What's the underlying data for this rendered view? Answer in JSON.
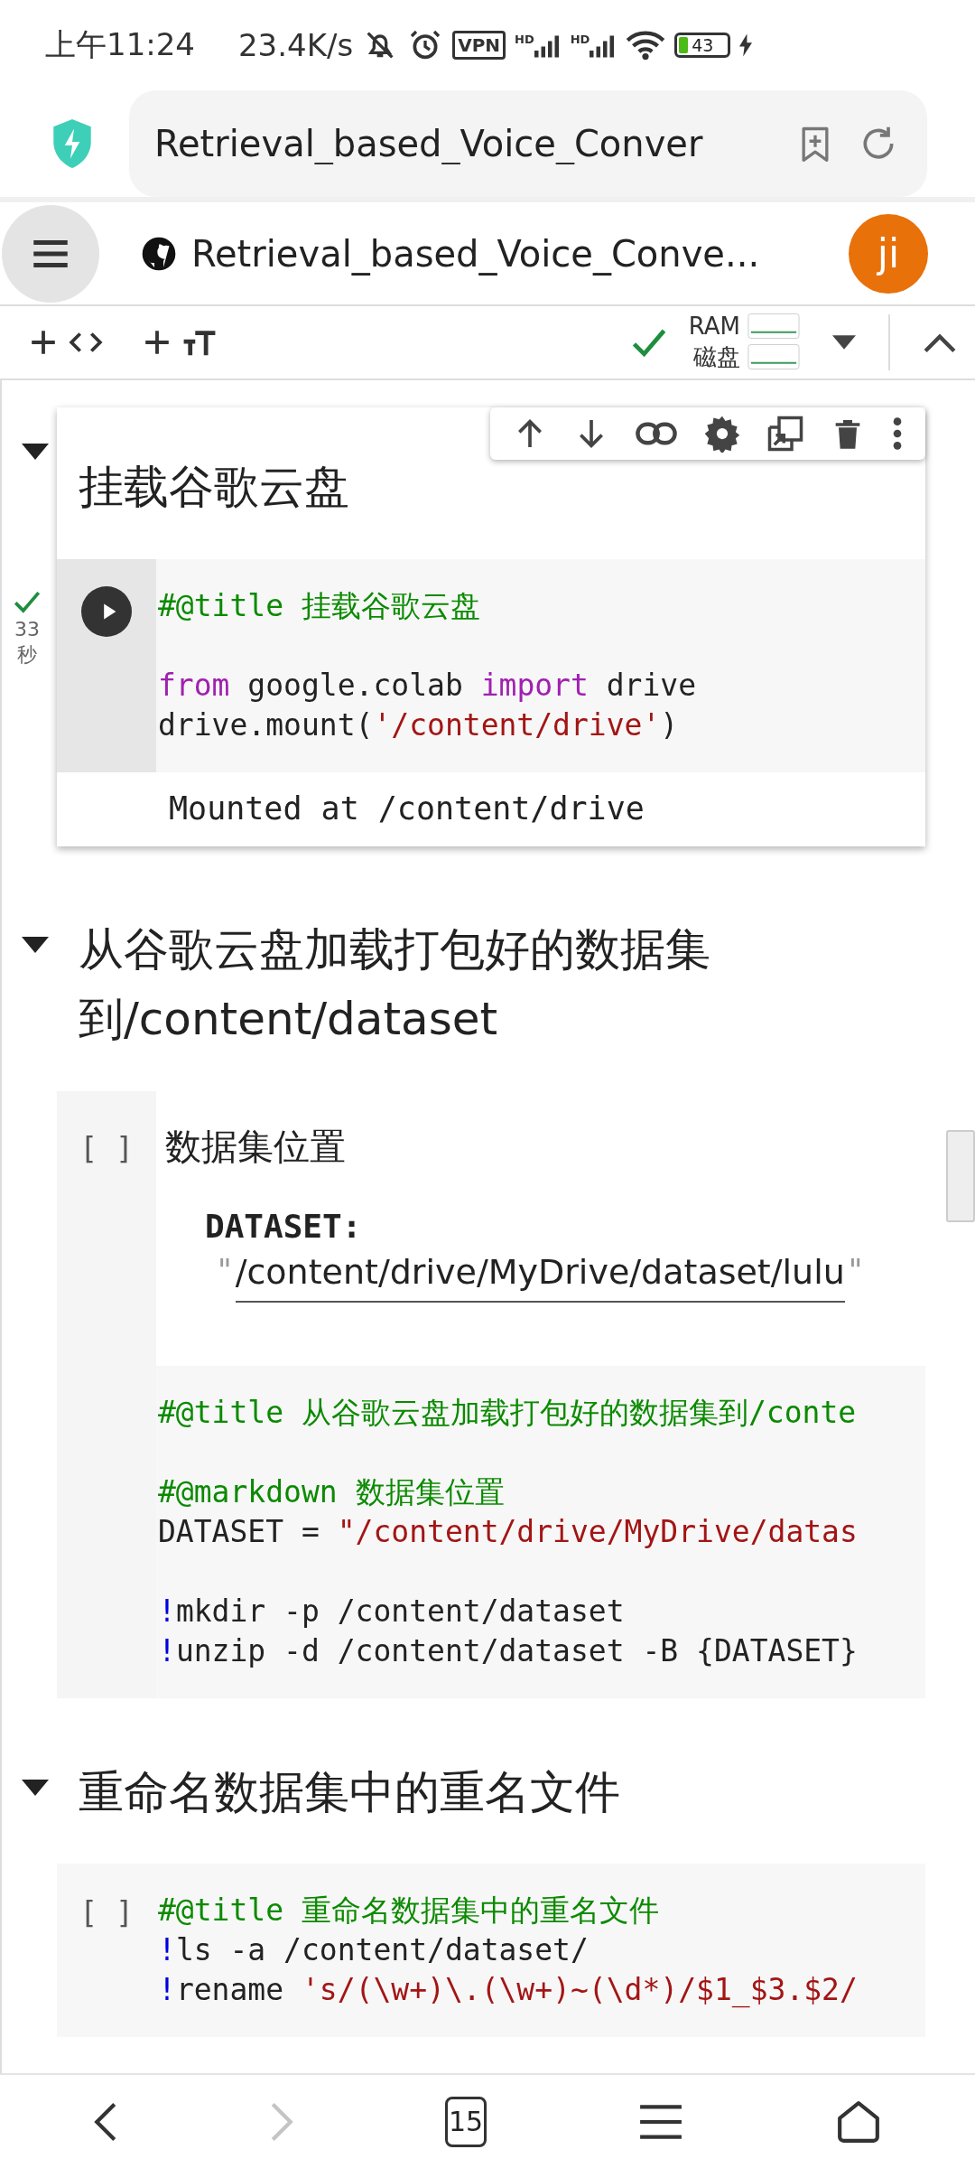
{
  "status_bar": {
    "time": "上午11:24",
    "net_speed": "23.4K/s",
    "vpn": "VPN",
    "signals": [
      "HD",
      "HD"
    ],
    "battery": "43"
  },
  "address_bar": {
    "url": "Retrieval_based_Voice_Conver"
  },
  "header": {
    "title": "Retrieval_based_Voice_Conve...",
    "avatar": "ji"
  },
  "toolbar": {
    "connected": true,
    "resources": [
      "RAM",
      "磁盘"
    ]
  },
  "sections": [
    {
      "title": "挂载谷歌云盘",
      "expanded": true,
      "focused": true,
      "cell": {
        "executed": true,
        "exec_time": "33",
        "exec_unit": "秒",
        "lines": [
          {
            "kind": "code",
            "tokens": [
              {
                "kind": "comment",
                "text": "#@title 挂载谷歌云盘"
              }
            ]
          },
          {
            "kind": "blank"
          },
          {
            "kind": "code",
            "tokens": [
              {
                "kind": "keyword",
                "text": "from"
              },
              {
                "kind": "plain",
                "text": " google.colab "
              },
              {
                "kind": "keyword",
                "text": "import"
              },
              {
                "kind": "plain",
                "text": " drive"
              }
            ]
          },
          {
            "kind": "code",
            "tokens": [
              {
                "kind": "plain",
                "text": "drive.mount("
              },
              {
                "kind": "string",
                "text": "'/content/drive'"
              },
              {
                "kind": "plain",
                "text": ")"
              }
            ]
          }
        ],
        "output": "Mounted at /content/drive"
      }
    },
    {
      "title": "从谷歌云盘加载打包好的数据集到/content/dataset",
      "expanded": true,
      "focused": false,
      "cell": {
        "executed": false,
        "gutter_label": "[ ]",
        "form": {
          "title": "数据集位置",
          "field_label": "DATASET:",
          "quote": "\"",
          "value": "/content/drive/MyDrive/dataset/lulu"
        },
        "lines": [
          {
            "kind": "code",
            "tokens": [
              {
                "kind": "comment",
                "text": "#@title 从谷歌云盘加载打包好的数据集到/conte"
              }
            ]
          },
          {
            "kind": "blank"
          },
          {
            "kind": "code",
            "tokens": [
              {
                "kind": "comment",
                "text": "#@markdown 数据集位置"
              }
            ]
          },
          {
            "kind": "code",
            "tokens": [
              {
                "kind": "plain",
                "text": "DATASET = "
              },
              {
                "kind": "string",
                "text": "\"/content/drive/MyDrive/datas"
              }
            ]
          },
          {
            "kind": "blank"
          },
          {
            "kind": "code",
            "tokens": [
              {
                "kind": "bang",
                "text": "!"
              },
              {
                "kind": "plain",
                "text": "mkdir -p /content/dataset"
              }
            ]
          },
          {
            "kind": "code",
            "tokens": [
              {
                "kind": "bang",
                "text": "!"
              },
              {
                "kind": "plain",
                "text": "unzip -d /content/dataset -B {DATASET}"
              }
            ]
          }
        ]
      }
    },
    {
      "title": "重命名数据集中的重名文件",
      "expanded": true,
      "focused": false,
      "cell": {
        "executed": false,
        "gutter_label": "[ ]",
        "lines": [
          {
            "kind": "code",
            "tokens": [
              {
                "kind": "comment",
                "text": "#@title 重命名数据集中的重名文件"
              }
            ]
          },
          {
            "kind": "code",
            "tokens": [
              {
                "kind": "bang",
                "text": "!"
              },
              {
                "kind": "plain",
                "text": "ls -a /content/dataset/"
              }
            ]
          },
          {
            "kind": "code",
            "tokens": [
              {
                "kind": "bang",
                "text": "!"
              },
              {
                "kind": "plain",
                "text": "rename "
              },
              {
                "kind": "string",
                "text": "'s/(\\w+)\\.(\\w+)~(\\d*)/$1_$3.$2/"
              }
            ]
          }
        ]
      }
    }
  ],
  "bottom_nav": {
    "tab_count": "15",
    "forward_disabled": true
  }
}
